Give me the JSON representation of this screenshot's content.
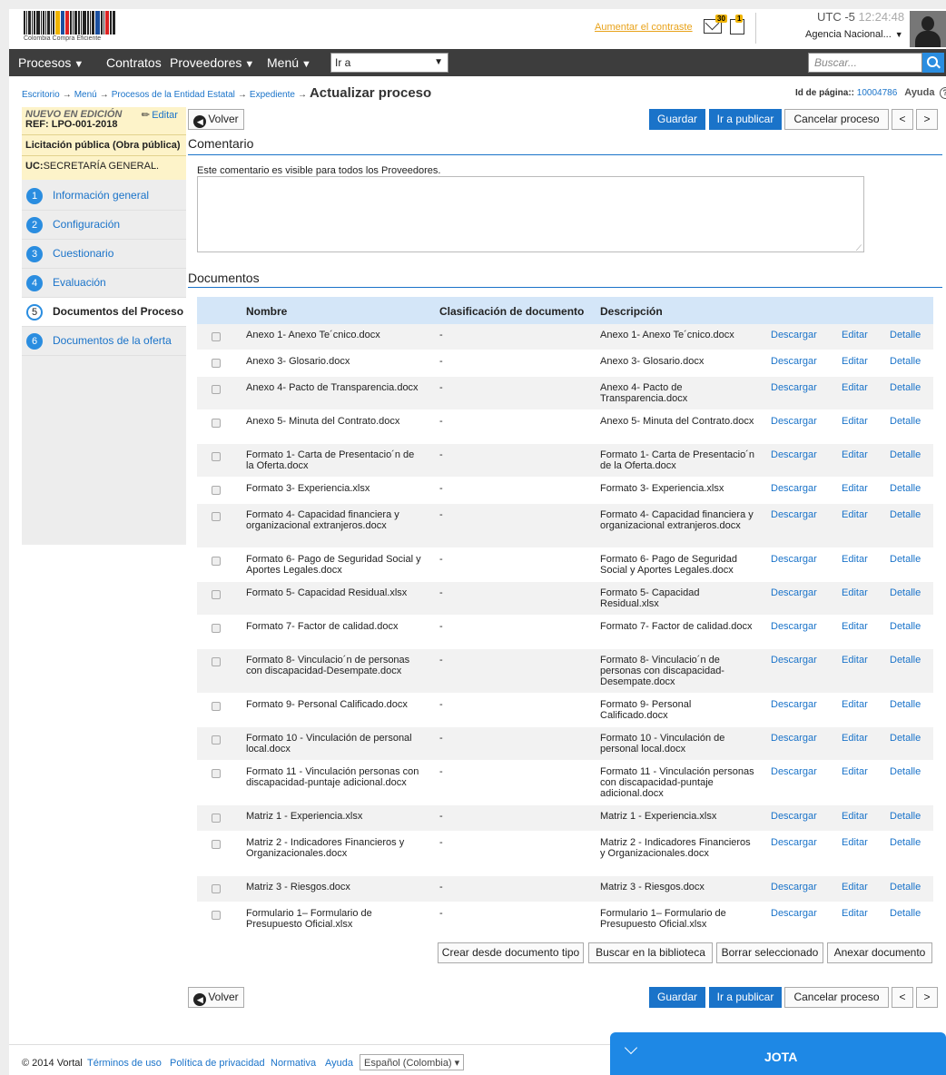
{
  "header": {
    "logo_caption": "Colombia Compra Eficiente",
    "contrast_link": "Aumentar el contraste",
    "messages_count": "30",
    "calendar_count": "1",
    "timezone": "UTC -5",
    "time": "12:24:48",
    "agency": "Agencia Nacional..."
  },
  "nav": {
    "items": [
      "Procesos",
      "Contratos",
      "Proveedores",
      "Menú"
    ],
    "goto_value": "Ir a",
    "search_placeholder": "Buscar..."
  },
  "breadcrumb": {
    "items": [
      "Escritorio",
      "Menú",
      "Procesos de la Entidad Estatal",
      "Expediente"
    ],
    "current": "Actualizar proceso",
    "page_id_label": "Id de página::",
    "page_id": "10004786",
    "help": "Ayuda"
  },
  "sidebar": {
    "status": "NUEVO EN EDICIÓN",
    "ref": "REF: LPO-001-2018",
    "edit_label": "Editar",
    "process_type": "Licitación pública (Obra pública)",
    "uc_label": "UC:",
    "uc_value": "SECRETARÍA GENERAL.",
    "steps": [
      {
        "num": "1",
        "label": "Información general"
      },
      {
        "num": "2",
        "label": "Configuración"
      },
      {
        "num": "3",
        "label": "Cuestionario"
      },
      {
        "num": "4",
        "label": "Evaluación"
      },
      {
        "num": "5",
        "label": "Documentos del Proceso"
      },
      {
        "num": "6",
        "label": "Documentos de la oferta"
      }
    ]
  },
  "actions": {
    "back": "Volver",
    "save": "Guardar",
    "publish": "Ir a publicar",
    "cancel": "Cancelar proceso",
    "prev": "<",
    "next": ">"
  },
  "comment": {
    "title": "Comentario",
    "note": "Este comentario es visible para todos los Proveedores.",
    "value": ""
  },
  "documents": {
    "title": "Documentos",
    "columns": [
      "Nombre",
      "Clasificación de documento",
      "Descripción"
    ],
    "action_labels": [
      "Descargar",
      "Editar",
      "Detalle"
    ],
    "rows": [
      {
        "name": "Anexo 1- Anexo Te´cnico.docx",
        "class": "-",
        "desc": "Anexo 1- Anexo Te´cnico.docx"
      },
      {
        "name": "Anexo 3- Glosario.docx",
        "class": "-",
        "desc": "Anexo 3- Glosario.docx"
      },
      {
        "name": "Anexo 4- Pacto de Transparencia.docx",
        "class": "-",
        "desc": "Anexo 4- Pacto de Transparencia.docx"
      },
      {
        "name": "Anexo 5- Minuta del Contrato.docx",
        "class": "-",
        "desc": "Anexo 5- Minuta del Contrato.docx"
      },
      {
        "name": "Formato 1- Carta de Presentacio´n de la Oferta.docx",
        "class": "-",
        "desc": "Formato 1- Carta de Presentacio´n de la Oferta.docx"
      },
      {
        "name": "Formato 3- Experiencia.xlsx",
        "class": "-",
        "desc": "Formato 3- Experiencia.xlsx"
      },
      {
        "name": "Formato 4- Capacidad financiera y organizacional extranjeros.docx",
        "class": "-",
        "desc": "Formato 4- Capacidad financiera y organizacional extranjeros.docx"
      },
      {
        "name": "Formato 6- Pago de Seguridad Social y Aportes Legales.docx",
        "class": "-",
        "desc": "Formato 6- Pago de Seguridad Social y Aportes Legales.docx"
      },
      {
        "name": "Formato 5- Capacidad Residual.xlsx",
        "class": "-",
        "desc": "Formato 5- Capacidad Residual.xlsx"
      },
      {
        "name": "Formato 7- Factor de calidad.docx",
        "class": "-",
        "desc": "Formato 7- Factor de calidad.docx"
      },
      {
        "name": "Formato 8- Vinculacio´n de personas con discapacidad-Desempate.docx",
        "class": "-",
        "desc": "Formato 8- Vinculacio´n de personas con discapacidad-Desempate.docx"
      },
      {
        "name": "Formato 9- Personal Calificado.docx",
        "class": "-",
        "desc": "Formato 9- Personal Calificado.docx"
      },
      {
        "name": "Formato 10 - Vinculación de personal local.docx",
        "class": "-",
        "desc": "Formato 10 - Vinculación de personal local.docx"
      },
      {
        "name": "Formato 11 - Vinculación personas con discapacidad-puntaje adicional.docx",
        "class": "-",
        "desc": "Formato 11 - Vinculación personas con discapacidad-puntaje adicional.docx"
      },
      {
        "name": "Matriz 1 - Experiencia.xlsx",
        "class": "-",
        "desc": "Matriz 1 - Experiencia.xlsx"
      },
      {
        "name": "Matriz 2 - Indicadores Financieros y Organizacionales.docx",
        "class": "-",
        "desc": "Matriz 2 - Indicadores Financieros y Organizacionales.docx"
      },
      {
        "name": "Matriz 3 - Riesgos.docx",
        "class": "-",
        "desc": "Matriz 3 - Riesgos.docx"
      },
      {
        "name": "Formulario 1– Formulario de Presupuesto Oficial.xlsx",
        "class": "-",
        "desc": "Formulario 1– Formulario de Presupuesto Oficial.xlsx"
      }
    ],
    "table_buttons": [
      "Crear desde documento tipo",
      "Buscar en la biblioteca",
      "Borrar seleccionado",
      "Anexar documento"
    ]
  },
  "footer": {
    "copyright": "© 2014 Vortal",
    "links": [
      "Términos de uso",
      "Política de privacidad",
      "Normativa",
      "Ayuda"
    ],
    "language": "Español (Colombia)"
  },
  "chat": {
    "name": "JOTA"
  }
}
